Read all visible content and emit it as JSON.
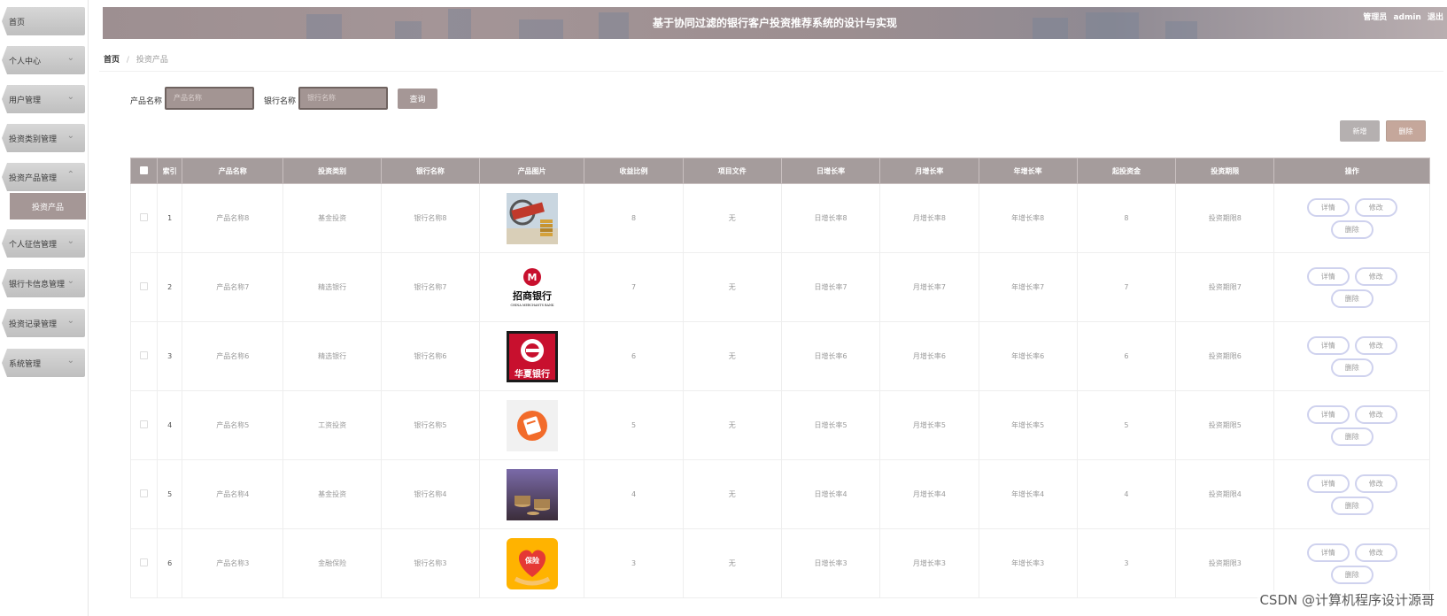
{
  "sidebar": {
    "items": [
      {
        "label": "首页",
        "has_arrow": false
      },
      {
        "label": "个人中心",
        "has_arrow": true
      },
      {
        "label": "用户管理",
        "has_arrow": true
      },
      {
        "label": "投资类别管理",
        "has_arrow": true
      },
      {
        "label": "投资产品管理",
        "has_arrow": true
      },
      {
        "label": "个人征信管理",
        "has_arrow": true
      },
      {
        "label": "银行卡信息管理",
        "has_arrow": true
      },
      {
        "label": "投资记录管理",
        "has_arrow": true
      },
      {
        "label": "系统管理",
        "has_arrow": true
      }
    ],
    "sub_item": "投资产品",
    "arrow_down": "⌄",
    "arrow_up": "⌃"
  },
  "header": {
    "title": "基于协同过滤的银行客户投资推荐系统的设计与实现",
    "role": "管理员",
    "user": "admin",
    "logout": "退出"
  },
  "breadcrumb": {
    "home": "首页",
    "sep": "/",
    "current": "投资产品"
  },
  "search": {
    "product_label": "产品名称",
    "product_placeholder": "产品名称",
    "bank_label": "银行名称",
    "bank_placeholder": "银行名称",
    "query_button": "查询"
  },
  "actions": {
    "add": "新增",
    "delete": "删除"
  },
  "table": {
    "headers": [
      "索引",
      "产品名称",
      "投资类别",
      "银行名称",
      "产品图片",
      "收益比例",
      "项目文件",
      "日增长率",
      "月增长率",
      "年增长率",
      "起投资金",
      "投资期限",
      "操作"
    ],
    "rows": [
      {
        "index": "1",
        "name": "产品名称8",
        "category": "基金投资",
        "bank": "银行名称8",
        "image": "investment-photo",
        "ratio": "8",
        "file": "无",
        "daily": "日增长率8",
        "monthly": "月增长率8",
        "yearly": "年增长率8",
        "min": "8",
        "term": "投资期限8"
      },
      {
        "index": "2",
        "name": "产品名称7",
        "category": "精选银行",
        "bank": "银行名称7",
        "image": "cmb-logo",
        "ratio": "7",
        "file": "无",
        "daily": "日增长率7",
        "monthly": "月增长率7",
        "yearly": "年增长率7",
        "min": "7",
        "term": "投资期限7"
      },
      {
        "index": "3",
        "name": "产品名称6",
        "category": "精选银行",
        "bank": "银行名称6",
        "image": "huaxia-logo",
        "ratio": "6",
        "file": "无",
        "daily": "日增长率6",
        "monthly": "月增长率6",
        "yearly": "年增长率6",
        "min": "6",
        "term": "投资期限6"
      },
      {
        "index": "4",
        "name": "产品名称5",
        "category": "工资投资",
        "bank": "银行名称5",
        "image": "orange-app-icon",
        "ratio": "5",
        "file": "无",
        "daily": "日增长率5",
        "monthly": "月增长率5",
        "yearly": "年增长率5",
        "min": "5",
        "term": "投资期限5"
      },
      {
        "index": "5",
        "name": "产品名称4",
        "category": "基金投资",
        "bank": "银行名称4",
        "image": "coins-photo",
        "ratio": "4",
        "file": "无",
        "daily": "日增长率4",
        "monthly": "月增长率4",
        "yearly": "年增长率4",
        "min": "4",
        "term": "投资期限4"
      },
      {
        "index": "6",
        "name": "产品名称3",
        "category": "金融保险",
        "bank": "银行名称3",
        "image": "insurance-icon",
        "ratio": "3",
        "file": "无",
        "daily": "日增长率3",
        "monthly": "月增长率3",
        "yearly": "年增长率3",
        "min": "3",
        "term": "投资期限3"
      }
    ],
    "row_actions": {
      "detail": "详情",
      "edit": "修改",
      "delete": "删除"
    }
  },
  "image_text": {
    "cmb_name": "招商银行",
    "cmb_english": "CHINA MERCHANTS BANK",
    "huaxia_name": "华夏银行",
    "insurance_tag": "保险"
  },
  "watermark": "CSDN @计算机程序设计源哥",
  "colors": {
    "accent": "#a59796",
    "header": "#9d8f91",
    "table_head": "#a59c9c",
    "op_border": "#cfd2ee"
  }
}
